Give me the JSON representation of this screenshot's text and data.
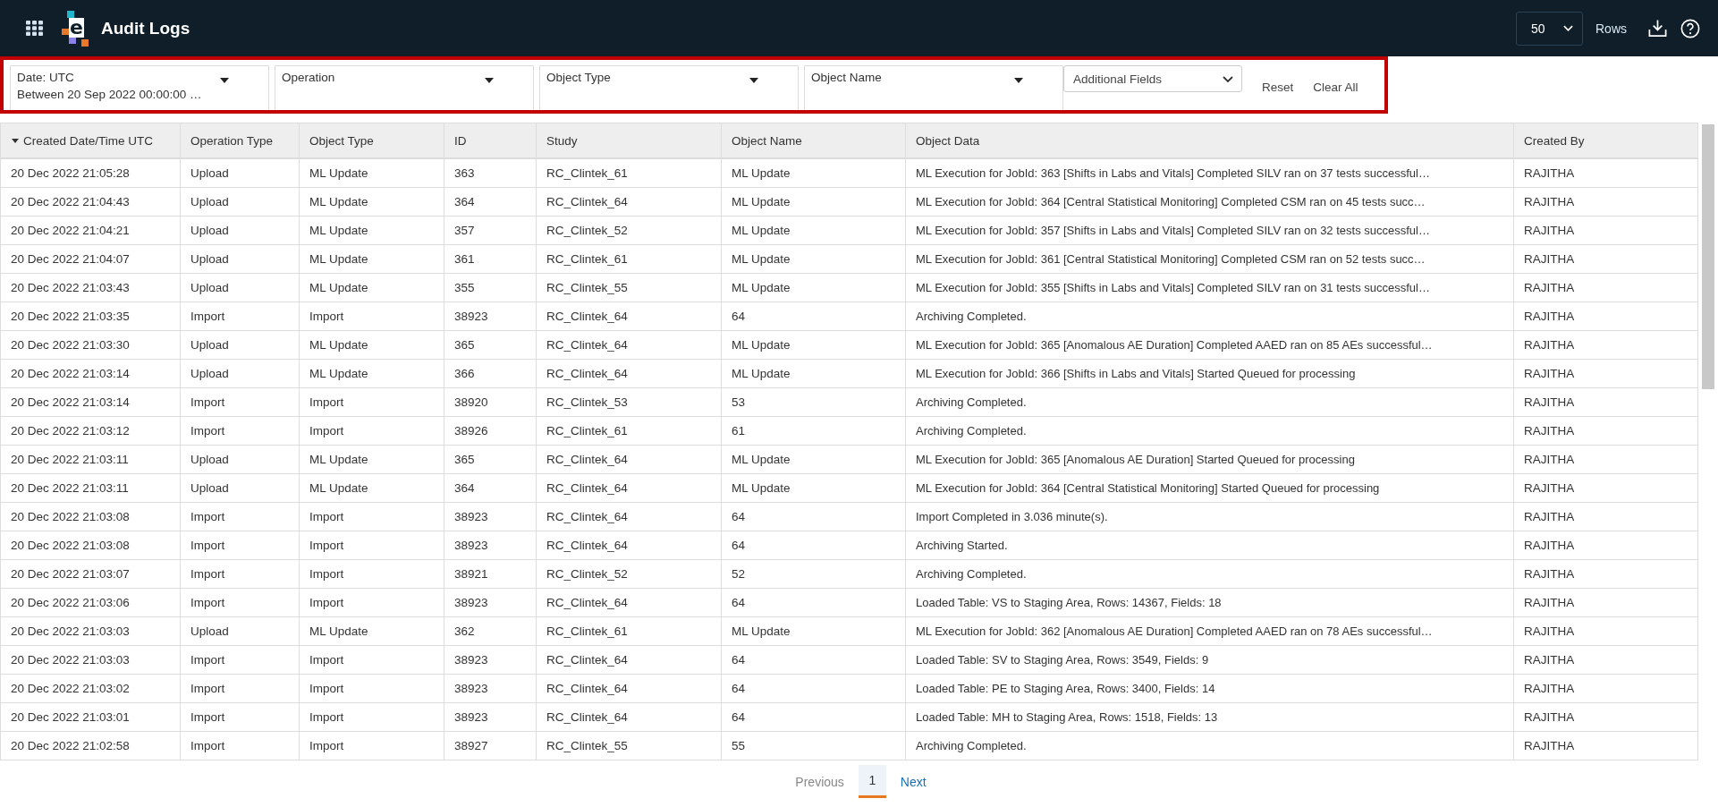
{
  "app": {
    "logo_text": "e",
    "title": "Audit Logs"
  },
  "rows_select": {
    "value": "50",
    "label": "Rows"
  },
  "filters": [
    {
      "label": "Date: UTC",
      "value": "Between 20 Sep 2022 00:00:00 …"
    },
    {
      "label": "Operation"
    },
    {
      "label": "Object Type"
    },
    {
      "label": "Object Name"
    }
  ],
  "additional_fields": {
    "label": "Additional Fields"
  },
  "reset": "Reset",
  "clear_all": "Clear All",
  "table": {
    "columns": [
      {
        "label": "Created Date/Time UTC",
        "sorted": true
      },
      {
        "label": "Operation Type",
        "sorted": false
      },
      {
        "label": "Object Type",
        "sorted": false
      },
      {
        "label": "ID",
        "sorted": false
      },
      {
        "label": "Study",
        "sorted": false
      },
      {
        "label": "Object Name",
        "sorted": false
      },
      {
        "label": "Object Data",
        "sorted": false
      },
      {
        "label": "Created By",
        "sorted": false
      }
    ],
    "rows": [
      [
        "20 Dec 2022 21:05:28",
        "Upload",
        "ML Update",
        "363",
        "RC_Clintek_61",
        "ML Update",
        "ML Execution for JobId: 363 [Shifts in Labs and Vitals] Completed SILV ran on 37 tests successful…",
        "RAJITHA"
      ],
      [
        "20 Dec 2022 21:04:43",
        "Upload",
        "ML Update",
        "364",
        "RC_Clintek_64",
        "ML Update",
        "ML Execution for JobId: 364 [Central Statistical Monitoring] Completed CSM ran on 45 tests succ…",
        "RAJITHA"
      ],
      [
        "20 Dec 2022 21:04:21",
        "Upload",
        "ML Update",
        "357",
        "RC_Clintek_52",
        "ML Update",
        "ML Execution for JobId: 357 [Shifts in Labs and Vitals] Completed SILV ran on 32 tests successful…",
        "RAJITHA"
      ],
      [
        "20 Dec 2022 21:04:07",
        "Upload",
        "ML Update",
        "361",
        "RC_Clintek_61",
        "ML Update",
        "ML Execution for JobId: 361 [Central Statistical Monitoring] Completed CSM ran on 52 tests succ…",
        "RAJITHA"
      ],
      [
        "20 Dec 2022 21:03:43",
        "Upload",
        "ML Update",
        "355",
        "RC_Clintek_55",
        "ML Update",
        "ML Execution for JobId: 355 [Shifts in Labs and Vitals] Completed SILV ran on 31 tests successful…",
        "RAJITHA"
      ],
      [
        "20 Dec 2022 21:03:35",
        "Import",
        "Import",
        "38923",
        "RC_Clintek_64",
        "64",
        "Archiving Completed.",
        "RAJITHA"
      ],
      [
        "20 Dec 2022 21:03:30",
        "Upload",
        "ML Update",
        "365",
        "RC_Clintek_64",
        "ML Update",
        "ML Execution for JobId: 365 [Anomalous AE Duration] Completed AAED ran on 85 AEs successful…",
        "RAJITHA"
      ],
      [
        "20 Dec 2022 21:03:14",
        "Upload",
        "ML Update",
        "366",
        "RC_Clintek_64",
        "ML Update",
        "ML Execution for JobId: 366 [Shifts in Labs and Vitals] Started Queued for processing",
        "RAJITHA"
      ],
      [
        "20 Dec 2022 21:03:14",
        "Import",
        "Import",
        "38920",
        "RC_Clintek_53",
        "53",
        "Archiving Completed.",
        "RAJITHA"
      ],
      [
        "20 Dec 2022 21:03:12",
        "Import",
        "Import",
        "38926",
        "RC_Clintek_61",
        "61",
        "Archiving Completed.",
        "RAJITHA"
      ],
      [
        "20 Dec 2022 21:03:11",
        "Upload",
        "ML Update",
        "365",
        "RC_Clintek_64",
        "ML Update",
        "ML Execution for JobId: 365 [Anomalous AE Duration] Started Queued for processing",
        "RAJITHA"
      ],
      [
        "20 Dec 2022 21:03:11",
        "Upload",
        "ML Update",
        "364",
        "RC_Clintek_64",
        "ML Update",
        "ML Execution for JobId: 364 [Central Statistical Monitoring] Started Queued for processing",
        "RAJITHA"
      ],
      [
        "20 Dec 2022 21:03:08",
        "Import",
        "Import",
        "38923",
        "RC_Clintek_64",
        "64",
        "Import Completed in 3.036 minute(s).",
        "RAJITHA"
      ],
      [
        "20 Dec 2022 21:03:08",
        "Import",
        "Import",
        "38923",
        "RC_Clintek_64",
        "64",
        "Archiving Started.",
        "RAJITHA"
      ],
      [
        "20 Dec 2022 21:03:07",
        "Import",
        "Import",
        "38921",
        "RC_Clintek_52",
        "52",
        "Archiving Completed.",
        "RAJITHA"
      ],
      [
        "20 Dec 2022 21:03:06",
        "Import",
        "Import",
        "38923",
        "RC_Clintek_64",
        "64",
        "Loaded Table: VS to Staging Area, Rows: 14367, Fields: 18",
        "RAJITHA"
      ],
      [
        "20 Dec 2022 21:03:03",
        "Upload",
        "ML Update",
        "362",
        "RC_Clintek_61",
        "ML Update",
        "ML Execution for JobId: 362 [Anomalous AE Duration] Completed AAED ran on 78 AEs successful…",
        "RAJITHA"
      ],
      [
        "20 Dec 2022 21:03:03",
        "Import",
        "Import",
        "38923",
        "RC_Clintek_64",
        "64",
        "Loaded Table: SV to Staging Area, Rows: 3549, Fields: 9",
        "RAJITHA"
      ],
      [
        "20 Dec 2022 21:03:02",
        "Import",
        "Import",
        "38923",
        "RC_Clintek_64",
        "64",
        "Loaded Table: PE to Staging Area, Rows: 3400, Fields: 14",
        "RAJITHA"
      ],
      [
        "20 Dec 2022 21:03:01",
        "Import",
        "Import",
        "38923",
        "RC_Clintek_64",
        "64",
        "Loaded Table: MH to Staging Area, Rows: 1518, Fields: 13",
        "RAJITHA"
      ],
      [
        "20 Dec 2022 21:02:58",
        "Import",
        "Import",
        "38927",
        "RC_Clintek_55",
        "55",
        "Archiving Completed.",
        "RAJITHA"
      ]
    ]
  },
  "pagination": {
    "previous": {
      "label": "Previous",
      "disabled": true
    },
    "pages": [
      {
        "label": "1",
        "selected": true
      }
    ],
    "next": {
      "label": "Next",
      "disabled": false
    }
  }
}
